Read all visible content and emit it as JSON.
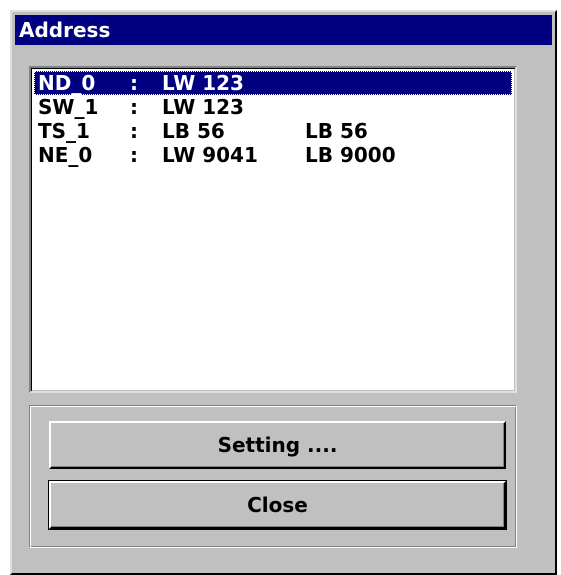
{
  "window": {
    "title": "Address"
  },
  "list": {
    "items": [
      {
        "name": "ND_0",
        "sep": ":",
        "addr1": "LW 123",
        "addr2": "",
        "selected": true
      },
      {
        "name": "SW_1",
        "sep": ":",
        "addr1": "LW 123",
        "addr2": "",
        "selected": false
      },
      {
        "name": "TS_1",
        "sep": ":",
        "addr1": "LB 56",
        "addr2": "LB 56",
        "selected": false
      },
      {
        "name": "NE_0",
        "sep": ":",
        "addr1": "LW 9041",
        "addr2": "LB 9000",
        "selected": false
      }
    ]
  },
  "buttons": {
    "setting_label": "Setting ....",
    "close_label": "Close"
  },
  "colors": {
    "titlebar": "#000080",
    "face": "#c0c0c0",
    "selection": "#000080"
  }
}
